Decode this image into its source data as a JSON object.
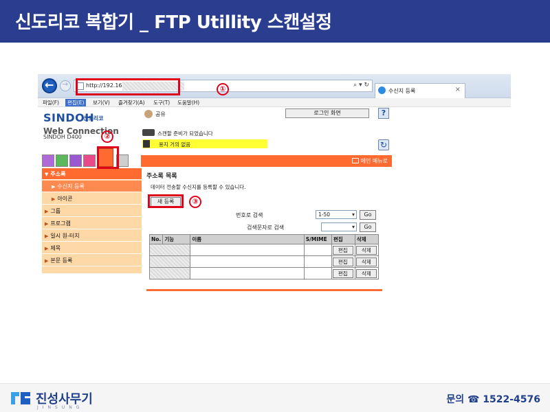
{
  "slide": {
    "title": "신도리코 복합기 _ FTP Utillity 스캔설정",
    "footer_logo": "진성사무기",
    "footer_logo_sub": "JINSUNG",
    "footer_contact": "문의 ☎ 1522-4576"
  },
  "annotations": [
    "①",
    "②",
    "③"
  ],
  "browser": {
    "url": "http://192.168.",
    "url_controls": "⌕ ▾ ↻",
    "tab_label": "수신지 등록",
    "tab_close": "×",
    "menu": [
      "파일(F)",
      "편집(E)",
      "보기(V)",
      "즐겨찾기(A)",
      "도구(T)",
      "도움말(H)"
    ]
  },
  "app": {
    "brand": "SINDOH",
    "brand_kr": "신도리코",
    "brand_sub": "Web Connection",
    "model": "SINDOH D400",
    "user": "공유",
    "login_button": "로그인 화면",
    "help_button": "?",
    "status_ready": "스캔할 준비가 되었습니다",
    "status_warning": "용지 거의 없음",
    "refresh_icon": "↻",
    "main_menu": "메인 메뉴로"
  },
  "left_menu": [
    {
      "label": "주소록",
      "level": 0
    },
    {
      "label": "수신지 등록",
      "level": 1
    },
    {
      "label": "아이콘",
      "level": 1
    },
    {
      "label": "그룹",
      "level": 0
    },
    {
      "label": "프로그램",
      "level": 0
    },
    {
      "label": "일시 원-터치",
      "level": 0
    },
    {
      "label": "제목",
      "level": 0
    },
    {
      "label": "본문 등록",
      "level": 0
    }
  ],
  "content": {
    "title": "주소록 목록",
    "description": "데이터 전송할 수신지를 등록할 수 있습니다.",
    "new_button": "새 등록",
    "search_by_number": "번호로 검색",
    "number_range": "1-50",
    "search_by_char": "검색문자로 검색",
    "char_value": "",
    "go_label": "Go",
    "table": {
      "headers": [
        "No.",
        "기능",
        "이름",
        "S/MIME",
        "편집",
        "삭제"
      ],
      "rows": [
        {
          "edit": "편집",
          "delete": "삭제"
        },
        {
          "edit": "편집",
          "delete": "삭제"
        },
        {
          "edit": "편집",
          "delete": "삭제"
        }
      ]
    }
  },
  "colors": {
    "title_bar": "#2a3d8f",
    "accent_orange": "#ff6a30",
    "highlight_red": "#e0001a",
    "warning_yellow": "#ffff33"
  }
}
